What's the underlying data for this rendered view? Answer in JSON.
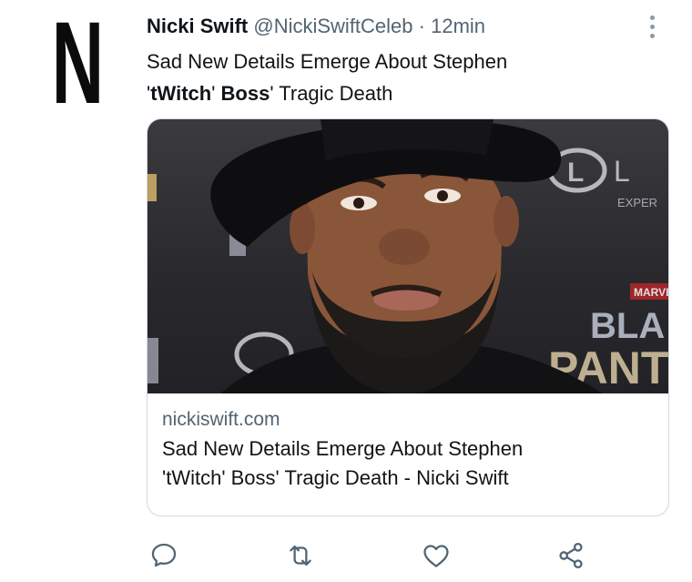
{
  "author": {
    "avatar_letter": "N",
    "name": "Nicki Swift",
    "handle": "@NickiSwiftCeleb",
    "separator": "·",
    "time": "12min"
  },
  "tweet": {
    "line1": "Sad New Details Emerge About Stephen",
    "line2_pre": "'",
    "line2_bold": "tWitch",
    "line2_mid": "' ",
    "line2_bold2": "Boss",
    "line2_post": "' Tragic Death"
  },
  "card": {
    "image_icon": "portrait-photo",
    "backdrop_logo_text_1": "L",
    "backdrop_logo_text_2": "L",
    "backdrop_small": "EXPER",
    "backdrop_marvel": "MARVEL",
    "backdrop_black": "BLA",
    "backdrop_panther": "PANT",
    "domain": "nickiswift.com",
    "title_line1": "Sad New Details Emerge About Stephen",
    "title_line2": "'tWitch' Boss' Tragic Death - Nicki Swift"
  },
  "actions": [
    {
      "icon": "reply-icon"
    },
    {
      "icon": "retweet-icon"
    },
    {
      "icon": "like-icon"
    },
    {
      "icon": "share-icon"
    }
  ],
  "colors": {
    "text": "#0f1419",
    "secondary": "#536471",
    "border": "#cfd9de",
    "icon": "#536471"
  }
}
